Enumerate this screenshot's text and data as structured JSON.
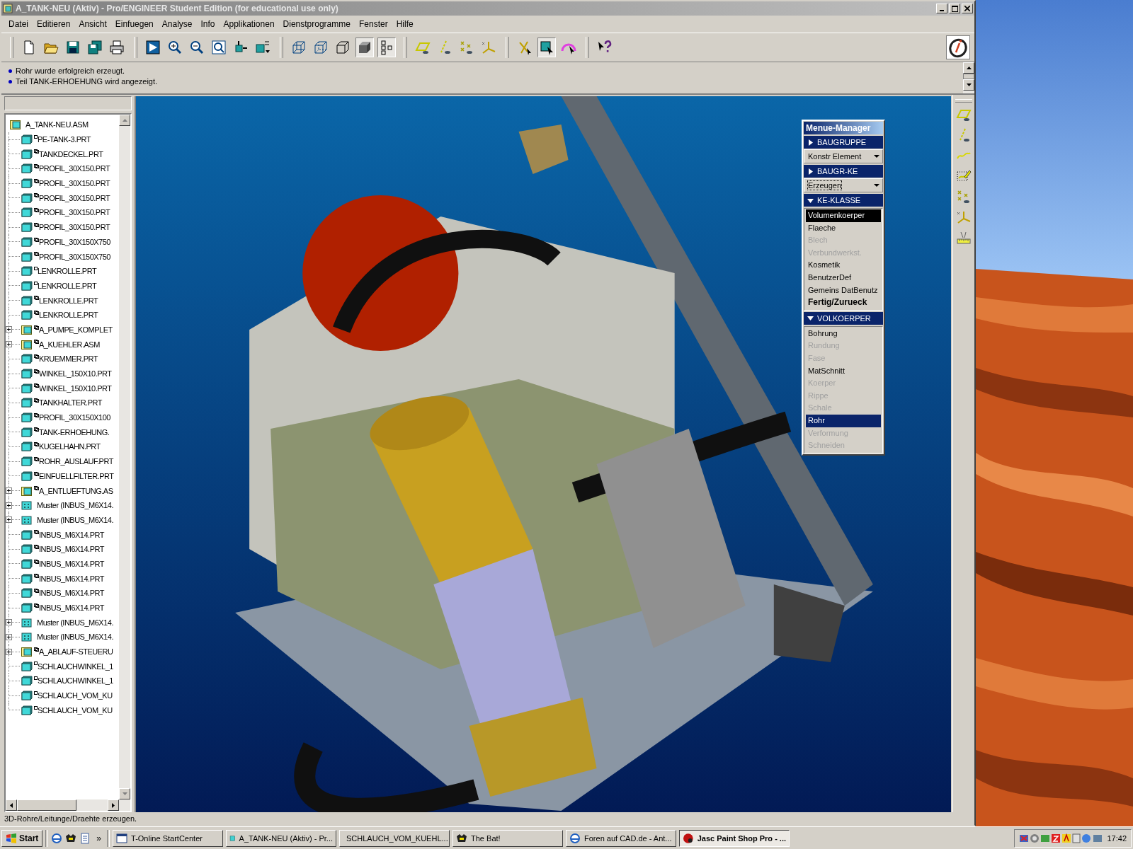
{
  "window": {
    "title": "A_TANK-NEU (Aktiv) - Pro/ENGINEER Student Edition (for educational use only)"
  },
  "menu": [
    "Datei",
    "Editieren",
    "Ansicht",
    "Einfuegen",
    "Analyse",
    "Info",
    "Applikationen",
    "Dienstprogramme",
    "Fenster",
    "Hilfe"
  ],
  "toolbar": [
    [
      {
        "kind": "document",
        "pressed": false
      },
      {
        "kind": "folder",
        "pressed": false
      },
      {
        "kind": "floppy",
        "pressed": false
      },
      {
        "kind": "floppies",
        "pressed": false
      },
      {
        "kind": "printer",
        "pressed": false
      }
    ],
    [
      {
        "kind": "repaint",
        "pressed": false
      },
      {
        "kind": "zoom-in",
        "pressed": false
      },
      {
        "kind": "zoom-out",
        "pressed": false
      },
      {
        "kind": "refit",
        "pressed": false
      },
      {
        "kind": "orient",
        "pressed": false
      },
      {
        "kind": "views",
        "pressed": false
      }
    ],
    [
      {
        "kind": "wireframe",
        "pressed": false
      },
      {
        "kind": "hidden",
        "pressed": false
      },
      {
        "kind": "outline",
        "pressed": false
      },
      {
        "kind": "shaded",
        "pressed": true
      },
      {
        "kind": "tree",
        "pressed": true
      }
    ],
    [
      {
        "kind": "plane",
        "pressed": false
      },
      {
        "kind": "axis",
        "pressed": false
      },
      {
        "kind": "points",
        "pressed": false
      },
      {
        "kind": "csys",
        "pressed": false
      }
    ],
    [
      {
        "kind": "crosslines",
        "pressed": false
      },
      {
        "kind": "cubecursor",
        "pressed": true
      },
      {
        "kind": "domecursor",
        "pressed": false
      }
    ],
    [
      {
        "kind": "helpcursor",
        "pressed": false
      }
    ]
  ],
  "messages": [
    "Rohr wurde erfolgreich erzeugt.",
    "Teil TANK-ERHOEHUNG wird angezeigt."
  ],
  "model_tree": {
    "root": {
      "label": "A_TANK-NEU.ASM",
      "kind": "assembly",
      "children": [
        {
          "label": "PE-TANK-3.PRT",
          "kind": "part"
        },
        {
          "label": "TANKDECKEL.PRT",
          "kind": "linked-part"
        },
        {
          "label": "PROFIL_30X150.PRT",
          "kind": "linked-part"
        },
        {
          "label": "PROFIL_30X150.PRT",
          "kind": "linked-part"
        },
        {
          "label": "PROFIL_30X150.PRT",
          "kind": "linked-part"
        },
        {
          "label": "PROFIL_30X150.PRT",
          "kind": "linked-part"
        },
        {
          "label": "PROFIL_30X150.PRT",
          "kind": "linked-part"
        },
        {
          "label": "PROFIL_30X150X750",
          "kind": "linked-part"
        },
        {
          "label": "PROFIL_30X150X750",
          "kind": "linked-part"
        },
        {
          "label": "LENKROLLE.PRT",
          "kind": "part"
        },
        {
          "label": "LENKROLLE.PRT",
          "kind": "part"
        },
        {
          "label": "LENKROLLE.PRT",
          "kind": "linked-part"
        },
        {
          "label": "LENKROLLE.PRT",
          "kind": "linked-part"
        },
        {
          "label": "A_PUMPE_KOMPLET",
          "kind": "linked-assembly",
          "expanded": false
        },
        {
          "label": "A_KUEHLER.ASM",
          "kind": "linked-assembly",
          "expanded": false
        },
        {
          "label": "KRUEMMER.PRT",
          "kind": "linked-part"
        },
        {
          "label": "WINKEL_150X10.PRT",
          "kind": "linked-part"
        },
        {
          "label": "WINKEL_150X10.PRT",
          "kind": "linked-part"
        },
        {
          "label": "TANKHALTER.PRT",
          "kind": "linked-part"
        },
        {
          "label": "PROFIL_30X150X100",
          "kind": "linked-part"
        },
        {
          "label": "TANK-ERHOEHUNG.",
          "kind": "linked-part"
        },
        {
          "label": "KUGELHAHN.PRT",
          "kind": "linked-part"
        },
        {
          "label": "ROHR_AUSLAUF.PRT",
          "kind": "linked-part"
        },
        {
          "label": "EINFUELLFILTER.PRT",
          "kind": "linked-part"
        },
        {
          "label": "A_ENTLUEFTUNG.AS",
          "kind": "linked-assembly",
          "expanded": false
        },
        {
          "label": "Muster (INBUS_M6X14.",
          "kind": "pattern",
          "expanded": false
        },
        {
          "label": "Muster (INBUS_M6X14.",
          "kind": "pattern",
          "expanded": false
        },
        {
          "label": "INBUS_M6X14.PRT",
          "kind": "linked-part"
        },
        {
          "label": "INBUS_M6X14.PRT",
          "kind": "linked-part"
        },
        {
          "label": "INBUS_M6X14.PRT",
          "kind": "linked-part"
        },
        {
          "label": "INBUS_M6X14.PRT",
          "kind": "linked-part"
        },
        {
          "label": "INBUS_M6X14.PRT",
          "kind": "linked-part"
        },
        {
          "label": "INBUS_M6X14.PRT",
          "kind": "linked-part"
        },
        {
          "label": "Muster (INBUS_M6X14.",
          "kind": "pattern",
          "expanded": false
        },
        {
          "label": "Muster (INBUS_M6X14.",
          "kind": "pattern",
          "expanded": false
        },
        {
          "label": "A_ABLAUF-STEUERU",
          "kind": "linked-assembly",
          "expanded": false
        },
        {
          "label": "SCHLAUCHWINKEL_1",
          "kind": "part"
        },
        {
          "label": "SCHLAUCHWINKEL_1",
          "kind": "part"
        },
        {
          "label": "SCHLAUCH_VOM_KU",
          "kind": "part"
        },
        {
          "label": "SCHLAUCH_VOM_KU",
          "kind": "part"
        }
      ]
    }
  },
  "menu_manager": {
    "title": "Menue-Manager",
    "sections": [
      {
        "label": "BAUGRUPPE",
        "expanded": false,
        "dropdown": {
          "value": "Konstr Element",
          "focused": false
        }
      },
      {
        "label": "BAUGR-KE",
        "expanded": false,
        "dropdown": {
          "value": "Erzeugen",
          "focused": true
        }
      },
      {
        "label": "KE-KLASSE",
        "expanded": true,
        "kind": "chosen",
        "items": [
          {
            "label": "Volumenkoerper",
            "kind": "option",
            "selected": true,
            "disabled": false
          },
          {
            "label": "Flaeche",
            "kind": "option",
            "selected": false,
            "disabled": false
          },
          {
            "label": "Blech",
            "kind": "option",
            "selected": false,
            "disabled": true
          },
          {
            "label": "Verbundwerkst.",
            "kind": "option",
            "selected": false,
            "disabled": true
          },
          {
            "label": "Kosmetik",
            "kind": "option",
            "selected": false,
            "disabled": false
          },
          {
            "label": "BenutzerDef",
            "kind": "option",
            "selected": false,
            "disabled": false
          },
          {
            "label": "Gemeins DatBenutz",
            "kind": "option",
            "selected": false,
            "disabled": false
          },
          {
            "label": "Fertig/Zurueck",
            "kind": "action",
            "selected": false,
            "disabled": false
          }
        ]
      },
      {
        "label": "VOLKOERPER",
        "expanded": true,
        "kind": "current",
        "items": [
          {
            "label": "Bohrung",
            "kind": "option",
            "selected": false,
            "disabled": false
          },
          {
            "label": "Rundung",
            "kind": "option",
            "selected": false,
            "disabled": true
          },
          {
            "label": "Fase",
            "kind": "option",
            "selected": false,
            "disabled": true
          },
          {
            "label": "MatSchnitt",
            "kind": "option",
            "selected": false,
            "disabled": false
          },
          {
            "label": "Koerper",
            "kind": "option",
            "selected": false,
            "disabled": true
          },
          {
            "label": "Rippe",
            "kind": "option",
            "selected": false,
            "disabled": true
          },
          {
            "label": "Schale",
            "kind": "option",
            "selected": false,
            "disabled": true
          },
          {
            "label": "Rohr",
            "kind": "option",
            "selected": true,
            "disabled": false
          },
          {
            "label": "Verformung",
            "kind": "option",
            "selected": false,
            "disabled": true
          },
          {
            "label": "Schneiden",
            "kind": "option",
            "selected": false,
            "disabled": true
          }
        ]
      }
    ]
  },
  "datum_toolbar": [
    {
      "kind": "plane"
    },
    {
      "kind": "axis"
    },
    {
      "kind": "curve"
    },
    {
      "kind": "sketch"
    },
    {
      "kind": "points"
    },
    {
      "kind": "csys"
    },
    {
      "kind": "measure"
    }
  ],
  "status_bar": "3D-Rohre/Leitunge/Draehte erzeugen.",
  "taskbar": {
    "start": "Start",
    "more": "»",
    "tasks": [
      {
        "label": "T-Online StartCenter",
        "kind": "app",
        "selected": false
      },
      {
        "label": "A_TANK-NEU (Aktiv) - Pr...",
        "kind": "part",
        "selected": false
      },
      {
        "label": "SCHLAUCH_VOM_KUEHL...",
        "kind": "part",
        "selected": false
      },
      {
        "label": "The Bat!",
        "kind": "bat",
        "selected": false
      },
      {
        "label": "Foren auf CAD.de - Ant...",
        "kind": "globe",
        "selected": false
      },
      {
        "label": "Jasc Paint Shop Pro - ...",
        "kind": "paint",
        "selected": true
      }
    ],
    "clock": "17:42"
  }
}
